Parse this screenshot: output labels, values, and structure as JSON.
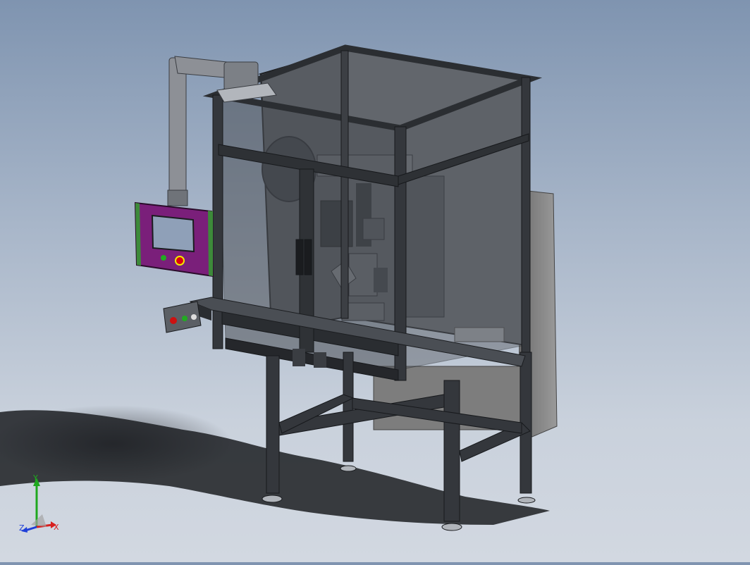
{
  "viewport": {
    "background_top": "#7f94b0",
    "background_bottom": "#d2d8e1",
    "model": "automated-machine-assembly",
    "colors": {
      "frame": "#3a3d42",
      "frame_dark": "#1f2124",
      "glass": "#555a60",
      "hmi_panel": "#7a1f7a",
      "hmi_screen": "#8fa0b8",
      "cabinet": "#8c8c8c",
      "shadow": "#1c1e22"
    },
    "icons": {
      "triad": "axis-triad-icon"
    }
  },
  "triad": {
    "x_label": "X",
    "y_label": "Y",
    "z_label": "Z",
    "x_color": "#d81f1f",
    "y_color": "#1fa81f",
    "z_color": "#1f3fd8"
  }
}
